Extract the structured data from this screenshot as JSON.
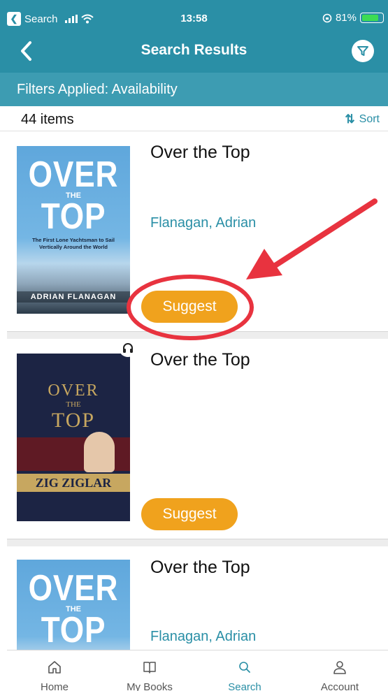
{
  "status_bar": {
    "back_app": "Search",
    "time": "13:58",
    "battery": "81%",
    "battery_level": 0.81
  },
  "nav": {
    "title": "Search Results",
    "back_icon": "chevron-left-icon",
    "filter_icon": "filter-icon"
  },
  "filters": {
    "text": "Filters Applied: Availability"
  },
  "results": {
    "count": "44 items",
    "sort_label": "Sort",
    "sort_icon": "sort-arrows-icon"
  },
  "books": [
    {
      "title": "Over the Top",
      "author": "Flanagan, Adrian",
      "action": "Suggest",
      "cover": {
        "line1": "OVER",
        "line2": "THE",
        "line3": "TOP",
        "subtitle": "The First Lone Yachtsman to Sail Vertically Around the World",
        "author": "ADRIAN FLANAGAN"
      }
    },
    {
      "title": "Over the Top",
      "author": "",
      "action": "Suggest",
      "audio": true,
      "cover": {
        "line1": "OVER",
        "line2": "THE",
        "line3": "TOP",
        "author": "ZIG ZIGLAR"
      }
    },
    {
      "title": "Over the Top",
      "author": "Flanagan, Adrian",
      "cover": {
        "line1": "OVER",
        "line2": "THE",
        "line3": "TOP"
      }
    }
  ],
  "tabs": [
    {
      "label": "Home",
      "icon": "home-icon"
    },
    {
      "label": "My Books",
      "icon": "book-icon"
    },
    {
      "label": "Search",
      "icon": "search-icon",
      "active": true
    },
    {
      "label": "Account",
      "icon": "account-icon"
    }
  ],
  "colors": {
    "primary": "#2a8fa6",
    "accent": "#f0a21d",
    "annotation": "#e8333f"
  }
}
